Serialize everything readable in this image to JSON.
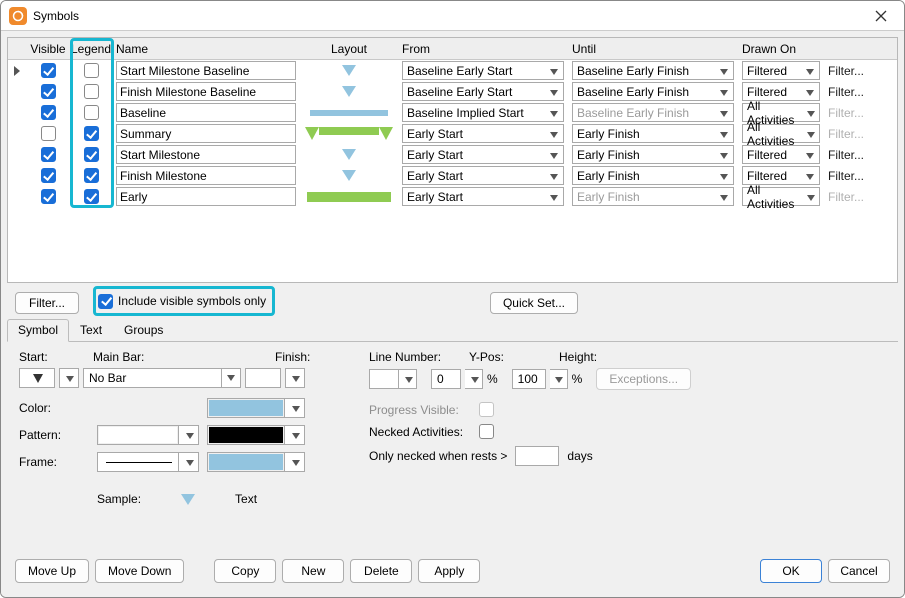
{
  "window": {
    "title": "Symbols"
  },
  "grid": {
    "headers": {
      "visible": "Visible",
      "legend": "Legend",
      "name": "Name",
      "layout": "Layout",
      "from": "From",
      "until": "Until",
      "drawn": "Drawn On"
    },
    "filter_link": "Filter...",
    "rows": [
      {
        "vis": true,
        "leg": false,
        "name": "Start Milestone Baseline",
        "layout": "tri-blue",
        "from": "Baseline Early Start",
        "until": "Baseline Early Finish",
        "drawn": "Filtered",
        "filter_dis": false
      },
      {
        "vis": true,
        "leg": false,
        "name": "Finish Milestone Baseline",
        "layout": "tri-blue",
        "from": "Baseline Early Start",
        "until": "Baseline Early Finish",
        "drawn": "Filtered",
        "filter_dis": false
      },
      {
        "vis": true,
        "leg": false,
        "name": "Baseline",
        "layout": "bar-blue",
        "from": "Baseline Implied Start",
        "until": "Baseline Early Finish",
        "until_dis": true,
        "drawn": "All Activities",
        "filter_dis": true
      },
      {
        "vis": false,
        "leg": true,
        "name": "Summary",
        "layout": "summary",
        "from": "Early Start",
        "until": "Early Finish",
        "drawn": "All Activities",
        "filter_dis": true
      },
      {
        "vis": true,
        "leg": true,
        "name": "Start Milestone",
        "layout": "tri-grn",
        "from": "Early Start",
        "until": "Early Finish",
        "drawn": "Filtered",
        "filter_dis": false
      },
      {
        "vis": true,
        "leg": true,
        "name": "Finish Milestone",
        "layout": "tri-grn",
        "from": "Early Start",
        "until": "Early Finish",
        "drawn": "Filtered",
        "filter_dis": false
      },
      {
        "vis": true,
        "leg": true,
        "name": "Early",
        "layout": "bar-grn",
        "from": "Early Start",
        "until": "Early Finish",
        "until_dis": true,
        "drawn": "All Activities",
        "filter_dis": true
      }
    ]
  },
  "controls": {
    "filter_btn": "Filter...",
    "include_label": "Include visible symbols only",
    "include_checked": true,
    "quickset": "Quick Set..."
  },
  "tabs": {
    "symbol": "Symbol",
    "text": "Text",
    "groups": "Groups"
  },
  "form": {
    "start": "Start:",
    "mainbar": "Main Bar:",
    "mainbar_val": "No Bar",
    "finish": "Finish:",
    "linenum": "Line Number:",
    "ypos": "Y-Pos:",
    "ypos_val": "0",
    "height": "Height:",
    "height_val": "100",
    "pct": "%",
    "exceptions": "Exceptions...",
    "color": "Color:",
    "pattern": "Pattern:",
    "frame": "Frame:",
    "progress": "Progress Visible:",
    "necked": "Necked Activities:",
    "only_necked": "Only necked when rests >",
    "days": "days",
    "sample": "Sample:",
    "sample_text": "Text"
  },
  "footer": {
    "moveup": "Move Up",
    "movedown": "Move Down",
    "copy": "Copy",
    "new": "New",
    "delete": "Delete",
    "apply": "Apply",
    "ok": "OK",
    "cancel": "Cancel"
  }
}
